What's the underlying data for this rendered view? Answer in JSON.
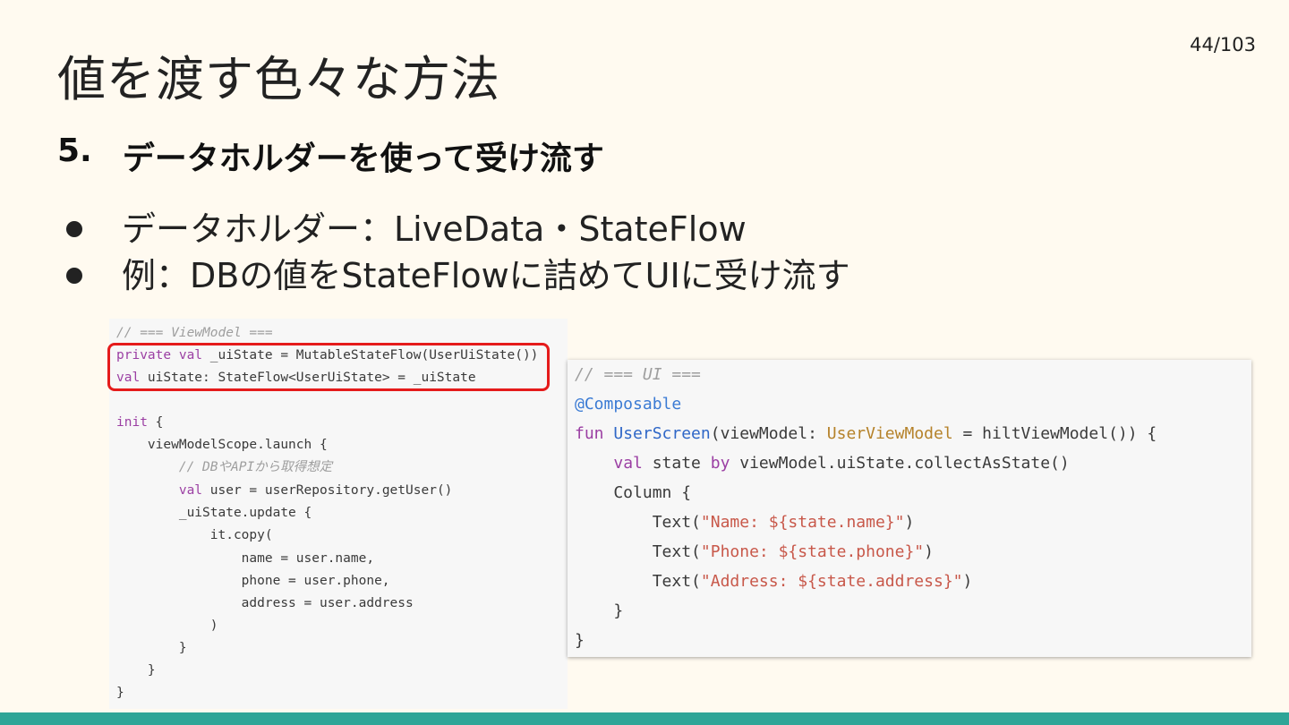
{
  "page_number": "44/103",
  "title": "値を渡す色々な方法",
  "subtitle": {
    "number": "5.",
    "text": "データホルダーを使って受け流す"
  },
  "bullets": [
    "データホルダー：LiveData・StateFlow",
    "例：DBの値をStateFlowに詰めてUIに受け流す"
  ],
  "code_left": {
    "comment_viewmodel": "// === ViewModel ===",
    "l2_kw": "private val",
    "l2_rest": " _uiState = MutableStateFlow(UserUiState())",
    "l3_kw": "val",
    "l3_rest": " uiState: StateFlow<UserUiState> = _uiState",
    "l5_kw": "init",
    "l5_rest": " {",
    "l6": "    viewModelScope.launch {",
    "l7_comment": "        // DBやAPIから取得想定",
    "l8_indent": "        ",
    "l8_kw": "val",
    "l8_rest": " user = userRepository.getUser()",
    "l9": "        _uiState.update {",
    "l10": "            it.copy(",
    "l11": "                name = user.name,",
    "l12": "                phone = user.phone,",
    "l13": "                address = user.address",
    "l14": "            )",
    "l15": "        }",
    "l16": "    }",
    "l17": "}"
  },
  "code_right": {
    "comment_ui": "// === UI ===",
    "annotation": "@Composable",
    "r3_kw": "fun",
    "r3_fn": "UserScreen",
    "r3_a": "(viewModel: ",
    "r3_type": "UserViewModel",
    "r3_b": " = hiltViewModel()) {",
    "r4_indent": "    ",
    "r4_kw": "val",
    "r4_a": " state ",
    "r4_kw2": "by",
    "r4_b": " viewModel.uiState.collectAsState()",
    "r5": "    Column {",
    "r6_a": "        Text(",
    "r6_str": "\"Name: ${state.name}\"",
    "r6_b": ")",
    "r7_a": "        Text(",
    "r7_str": "\"Phone: ${state.phone}\"",
    "r7_b": ")",
    "r8_a": "        Text(",
    "r8_str": "\"Address: ${state.address}\"",
    "r8_b": ")",
    "r9": "    }",
    "r10": "}"
  },
  "colors": {
    "background": "#fffaf0",
    "accent_bar": "#2ea597",
    "highlight_border": "#e51b1b",
    "keyword": "#9b3fa3",
    "string": "#c8584a",
    "type": "#b5822a",
    "function": "#2f67c7",
    "annotation": "#3b7bd4",
    "comment": "#9e9e9e"
  }
}
